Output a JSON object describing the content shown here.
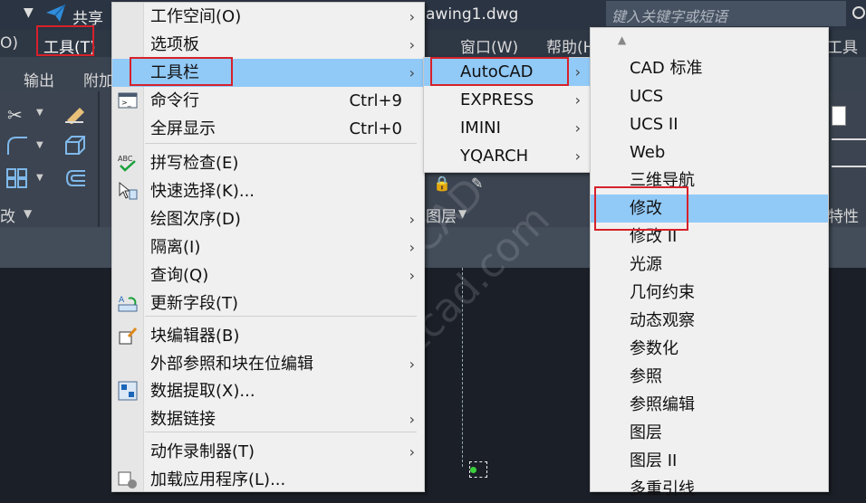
{
  "titlebar": {
    "share_label": "共享",
    "file_name": "awing1.dwg",
    "search_placeholder": "键入关键字或短语"
  },
  "menubar": {
    "left_fragment": "O)",
    "tools": "工具(T)",
    "window": "窗口(W)",
    "help": "帮助(H",
    "right_fragment": "工具"
  },
  "ribbon": {
    "tab_output": "输出",
    "tab_addon": "附加",
    "panel_modify": "改",
    "panel_layer": "图层",
    "panel_props": "特性"
  },
  "tools_menu": {
    "items": [
      {
        "label": "工作空间(O)",
        "shortcut": "",
        "arrow": "›"
      },
      {
        "label": "选项板",
        "shortcut": "",
        "arrow": "›"
      },
      {
        "label": "工具栏",
        "shortcut": "",
        "arrow": "›"
      },
      {
        "label": "命令行",
        "shortcut": "Ctrl+9",
        "arrow": ""
      },
      {
        "label": "全屏显示",
        "shortcut": "Ctrl+0",
        "arrow": ""
      },
      {
        "label": "拼写检查(E)",
        "shortcut": "",
        "arrow": ""
      },
      {
        "label": "快速选择(K)...",
        "shortcut": "",
        "arrow": ""
      },
      {
        "label": "绘图次序(D)",
        "shortcut": "",
        "arrow": "›"
      },
      {
        "label": "隔离(I)",
        "shortcut": "",
        "arrow": "›"
      },
      {
        "label": "查询(Q)",
        "shortcut": "",
        "arrow": "›"
      },
      {
        "label": "更新字段(T)",
        "shortcut": "",
        "arrow": ""
      },
      {
        "label": "块编辑器(B)",
        "shortcut": "",
        "arrow": ""
      },
      {
        "label": "外部参照和块在位编辑",
        "shortcut": "",
        "arrow": "›"
      },
      {
        "label": "数据提取(X)...",
        "shortcut": "",
        "arrow": ""
      },
      {
        "label": "数据链接",
        "shortcut": "",
        "arrow": "›"
      },
      {
        "label": "动作录制器(T)",
        "shortcut": "",
        "arrow": "›"
      },
      {
        "label": "加载应用程序(L)...",
        "shortcut": "",
        "arrow": ""
      }
    ]
  },
  "toolbar_menu": {
    "items": [
      {
        "label": "AutoCAD",
        "arrow": "›"
      },
      {
        "label": "EXPRESS",
        "arrow": "›"
      },
      {
        "label": "IMINI",
        "arrow": "›"
      },
      {
        "label": "YQARCH",
        "arrow": "›"
      }
    ]
  },
  "autocad_menu": {
    "scroll_up": "▲",
    "items": [
      "CAD 标准",
      "UCS",
      "UCS II",
      "Web",
      "三维导航",
      "修改",
      "修改 II",
      "光源",
      "几何约束",
      "动态观察",
      "参数化",
      "参照",
      "参照编辑",
      "图层",
      "图层 II",
      "多重引线"
    ]
  },
  "watermark": {
    "text1": "周站长CAD",
    "text2": "zzzcad.com"
  },
  "colors": {
    "highlight": "#91c9f7",
    "annotation_red": "#d6212a",
    "menu_bg": "#f0f0f0"
  }
}
